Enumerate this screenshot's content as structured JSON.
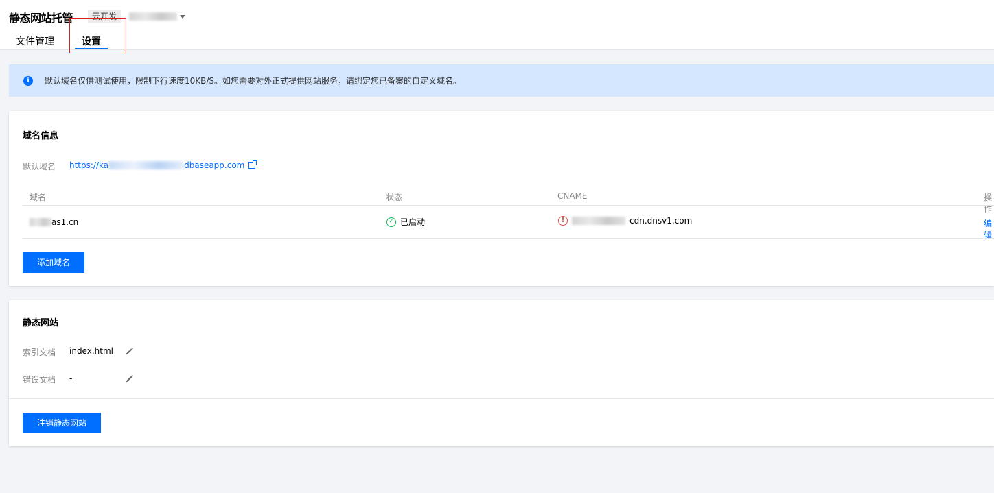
{
  "header": {
    "title": "静态网站托管",
    "env_tag": "云开发",
    "tabs": [
      {
        "label": "文件管理",
        "active": false
      },
      {
        "label": "设置",
        "active": true
      }
    ]
  },
  "notice": {
    "text": "默认域名仅供测试使用，限制下行速度10KB/S。如您需要对外正式提供网站服务，请绑定您已备案的自定义域名。"
  },
  "domain_card": {
    "title": "域名信息",
    "default_domain_label": "默认域名",
    "default_domain_prefix": "https://ka",
    "default_domain_suffix": "dbaseapp.com",
    "columns": [
      "域名",
      "状态",
      "CNAME",
      "操作"
    ],
    "rows": [
      {
        "domain_suffix": "as1.cn",
        "status": "已启动",
        "cname_suffix": "cdn.dnsv1.com",
        "action": "编辑"
      }
    ],
    "add_button": "添加域名"
  },
  "static_card": {
    "title": "静态网站",
    "index_label": "索引文档",
    "index_value": "index.html",
    "error_label": "错误文档",
    "error_value": "-",
    "cancel_button": "注销静态网站"
  },
  "colors": {
    "primary": "#006eff",
    "success": "#0abf5b",
    "danger": "#e54545",
    "notice_bg": "#d5e7ff",
    "highlight": "#e02020"
  }
}
